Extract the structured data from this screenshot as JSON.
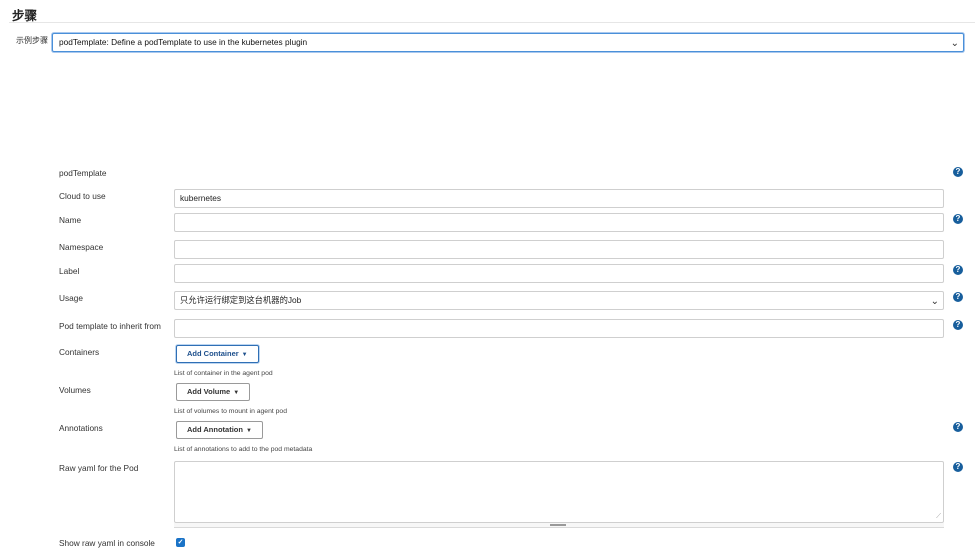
{
  "section": {
    "title": "步骤",
    "sample_step_label": "示例步骤",
    "sample_step_value": "podTemplate: Define a podTemplate to use in the kubernetes plugin"
  },
  "form": {
    "podTemplate_label": "podTemplate",
    "cloud": {
      "label": "Cloud to use",
      "value": "kubernetes"
    },
    "name": {
      "label": "Name",
      "value": ""
    },
    "namespace": {
      "label": "Namespace",
      "value": ""
    },
    "label": {
      "label": "Label",
      "value": ""
    },
    "usage": {
      "label": "Usage",
      "value": "只允许运行绑定到这台机器的Job"
    },
    "inherit": {
      "label": "Pod template to inherit from",
      "value": ""
    },
    "containers": {
      "label": "Containers",
      "button": "Add Container",
      "hint": "List of container in the agent pod"
    },
    "volumes": {
      "label": "Volumes",
      "button": "Add Volume",
      "hint": "List of volumes to mount in agent pod"
    },
    "annotations": {
      "label": "Annotations",
      "button": "Add Annotation",
      "hint": "List of annotations to add to the pod metadata"
    },
    "raw_yaml": {
      "label": "Raw yaml for the Pod",
      "value": ""
    },
    "show_raw_yaml": {
      "label": "Show raw yaml in console",
      "checked": true
    }
  },
  "icons": {
    "help": "help-icon",
    "dropdown": "chevron-down-icon",
    "checkbox": "check-icon"
  },
  "colors": {
    "help_icon": "#175e9c",
    "focus_border": "#4a90d9",
    "checkbox": "#1a73c7"
  }
}
